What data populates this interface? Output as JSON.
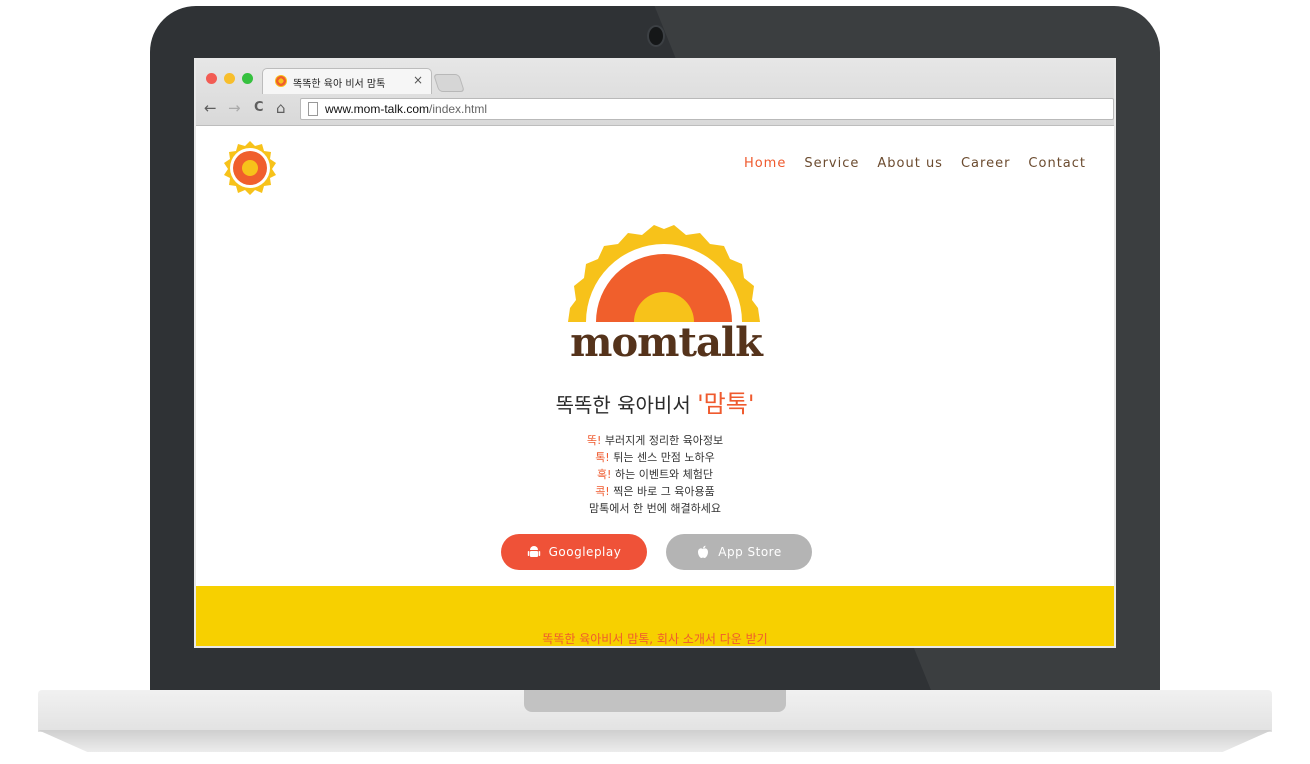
{
  "browser": {
    "tab_title": "똑똑한 육아 비서 맘톡",
    "tab_close": "×",
    "url_host": "www.mom-talk.com",
    "url_path": "/index.html",
    "back_glyph": "←",
    "forward_glyph": "→",
    "reload_glyph": "C",
    "home_glyph": "⌂"
  },
  "nav": {
    "items": [
      {
        "label": "Home",
        "active": true
      },
      {
        "label": "Service"
      },
      {
        "label": "About us"
      },
      {
        "label": "Career"
      },
      {
        "label": "Contact"
      }
    ]
  },
  "hero": {
    "wordmark": "momtalk",
    "headline_prefix": "똑똑한 육아비서 ",
    "headline_highlight": "'맘톡'",
    "points": [
      {
        "key": "똑!",
        "text": " 부러지게 정리한 육아정보"
      },
      {
        "key": "톡!",
        "text": " 튀는 센스 만점 노하우"
      },
      {
        "key": "혹!",
        "text": " 하는 이벤트와 체험단"
      },
      {
        "key": "콕!",
        "text": " 찍은 바로 그 육아용품"
      },
      {
        "key": "",
        "text": "맘톡에서 한 번에 해결하세요"
      }
    ],
    "buttons": {
      "google": "Googleplay",
      "apple": "App Store"
    }
  },
  "band": {
    "text": "똑똑한 육아비서 맘톡, 회사 소개서 다운 받기"
  },
  "colors": {
    "accent": "#ef5a2e",
    "brand_brown": "#55331b",
    "brand_yellow": "#f7d000",
    "apple_button": "#b4b4b4",
    "google_button": "#ef5238"
  },
  "icons": [
    "android-icon",
    "apple-icon",
    "page-icon",
    "favicon"
  ]
}
